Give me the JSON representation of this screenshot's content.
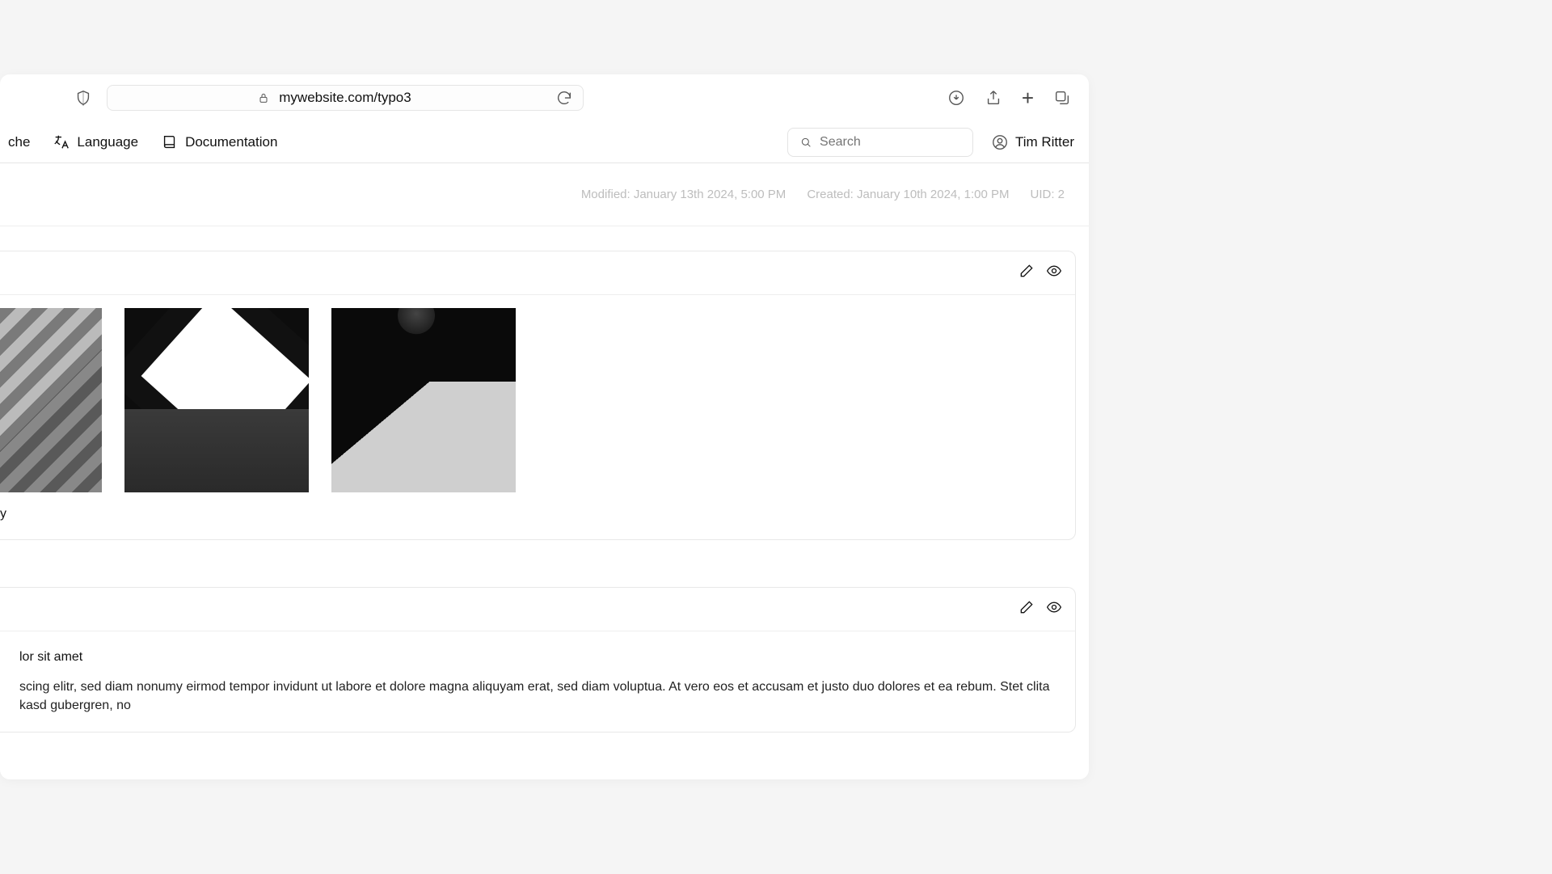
{
  "browser": {
    "url": "mywebsite.com/typo3"
  },
  "cms_toolbar": {
    "truncated_item": "che",
    "language_label": "Language",
    "documentation_label": "Documentation",
    "search_placeholder": "Search",
    "user_name": "Tim Ritter"
  },
  "meta": {
    "modified": "Modified: January 13th 2024, 5:00 PM",
    "created": "Created: January 10th 2024, 1:00 PM",
    "uid": "UID: 2"
  },
  "panels": {
    "gallery": {
      "caption_fragment": "y"
    },
    "text": {
      "title_fragment": "lor sit amet",
      "body_fragment": "scing elitr, sed diam nonumy eirmod tempor invidunt ut labore et dolore magna aliquyam erat, sed diam voluptua. At vero eos et accusam et justo duo dolores et ea rebum. Stet clita kasd gubergren, no"
    }
  }
}
